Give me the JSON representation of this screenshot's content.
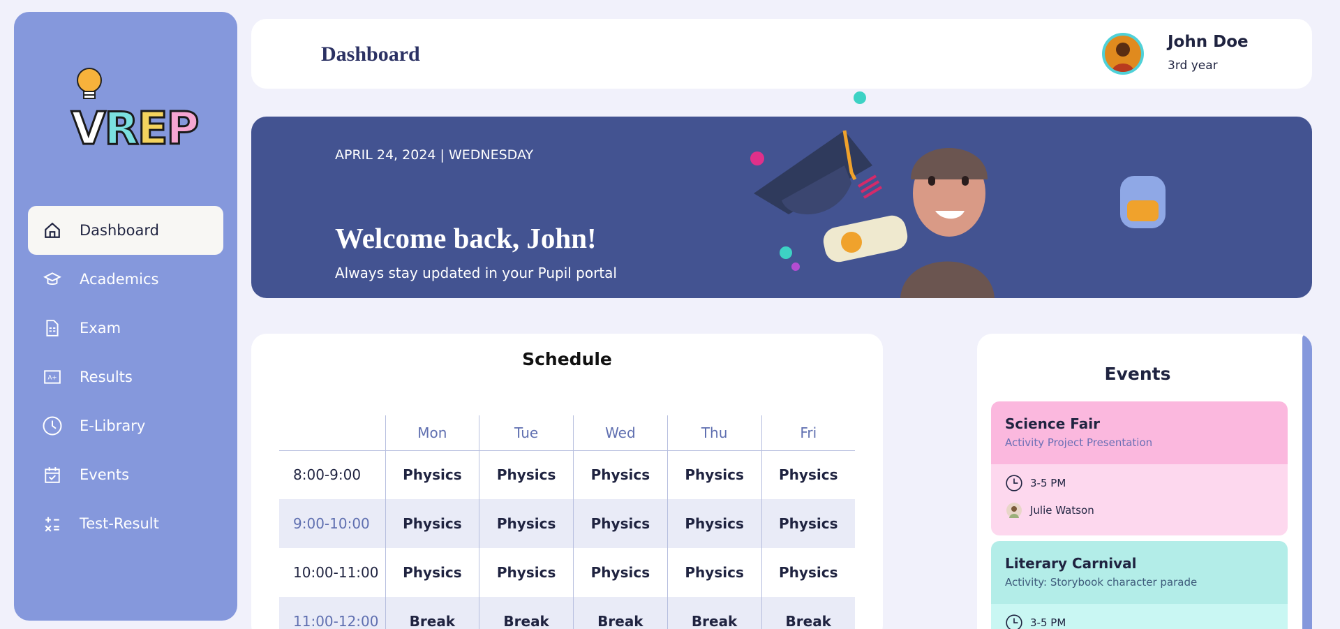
{
  "app": {
    "logo_text": "VREP"
  },
  "sidebar": {
    "items": [
      {
        "label": "Dashboard",
        "icon": "home-icon",
        "active": true
      },
      {
        "label": "Academics",
        "icon": "graduation-cap-icon"
      },
      {
        "label": "Exam",
        "icon": "document-icon"
      },
      {
        "label": "Results",
        "icon": "grade-card-icon"
      },
      {
        "label": "E-Library",
        "icon": "clock-icon"
      },
      {
        "label": "Events",
        "icon": "calendar-check-icon"
      },
      {
        "label": "Test-Result",
        "icon": "calculator-icon"
      }
    ]
  },
  "header": {
    "title": "Dashboard",
    "user": {
      "name": "John Doe",
      "year": "3rd year"
    }
  },
  "banner": {
    "date": "APRIL 24, 2024 | WEDNESDAY",
    "welcome": "Welcome back, John!",
    "subtitle": "Always stay updated in your Pupil portal"
  },
  "schedule": {
    "title": "Schedule",
    "days": [
      "Mon",
      "Tue",
      "Wed",
      "Thu",
      "Fri"
    ],
    "rows": [
      {
        "time": "8:00-9:00",
        "cells": [
          "Physics",
          "Physics",
          "Physics",
          "Physics",
          "Physics"
        ]
      },
      {
        "time": "9:00-10:00",
        "cells": [
          "Physics",
          "Physics",
          "Physics",
          "Physics",
          "Physics"
        ]
      },
      {
        "time": "10:00-11:00",
        "cells": [
          "Physics",
          "Physics",
          "Physics",
          "Physics",
          "Physics"
        ]
      },
      {
        "time": "11:00-12:00",
        "cells": [
          "Break",
          "Break",
          "Break",
          "Break",
          "Break"
        ]
      }
    ]
  },
  "events": {
    "title": "Events",
    "items": [
      {
        "name": "Science Fair",
        "description": "Activity Project Presentation",
        "time": "3-5 PM",
        "host": "Julie Watson",
        "head_color": "#fbb8de",
        "body_color": "#fdd8ee",
        "desc_color": "#6a6fb5"
      },
      {
        "name": "Literary Carnival",
        "description": "Activity: Storybook character parade",
        "time": "3-5 PM",
        "host": "",
        "head_color": "#b3ede8",
        "body_color": "#c9f7f3",
        "desc_color": "#3d5a7a"
      }
    ]
  }
}
